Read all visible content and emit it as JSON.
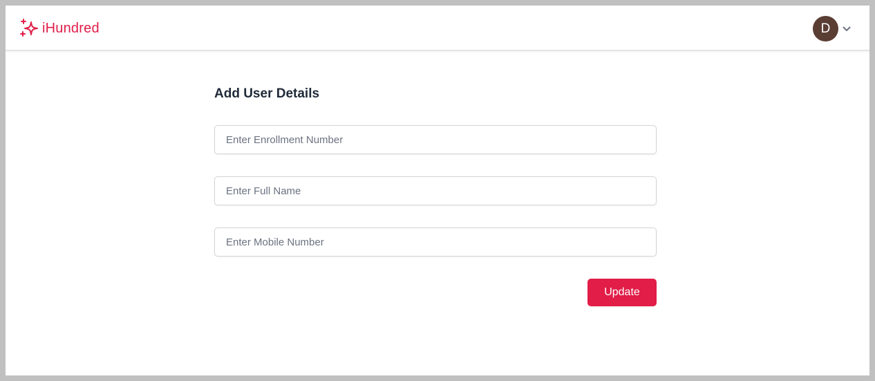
{
  "app": {
    "name": "iHundred",
    "logo_icon": "sparkles-icon",
    "accent_color": "#e11d48"
  },
  "user_menu": {
    "avatar_initial": "D",
    "avatar_color": "#5a3d33",
    "dropdown_icon": "chevron-down-icon"
  },
  "form": {
    "title": "Add User Details",
    "fields": [
      {
        "name": "enrollment_number",
        "value": "",
        "placeholder": "Enter Enrollment Number"
      },
      {
        "name": "full_name",
        "value": "",
        "placeholder": "Enter Full Name"
      },
      {
        "name": "mobile_number",
        "value": "",
        "placeholder": "Enter Mobile Number"
      }
    ],
    "submit_label": "Update"
  }
}
